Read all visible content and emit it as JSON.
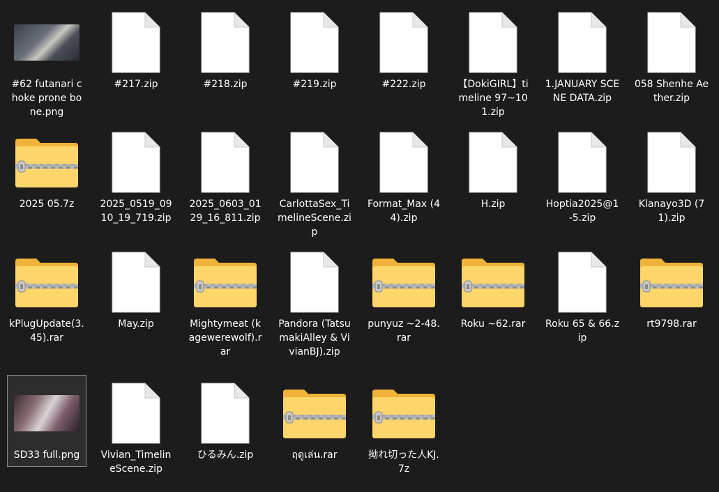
{
  "files": [
    {
      "name": "#62 futanari choke prone bone.png",
      "kind": "image",
      "thumb": "t1"
    },
    {
      "name": "#217.zip",
      "kind": "document"
    },
    {
      "name": "#218.zip",
      "kind": "document"
    },
    {
      "name": "#219.zip",
      "kind": "document"
    },
    {
      "name": "#222.zip",
      "kind": "document"
    },
    {
      "name": "【DokiGIRL】timeline 97~101.zip",
      "kind": "document"
    },
    {
      "name": "1.JANUARY SCENE DATA.zip",
      "kind": "document"
    },
    {
      "name": "058 Shenhe Aether.zip",
      "kind": "document"
    },
    {
      "name": "2025 05.7z",
      "kind": "zip-folder"
    },
    {
      "name": "2025_0519_0910_19_719.zip",
      "kind": "document"
    },
    {
      "name": "2025_0603_0129_16_811.zip",
      "kind": "document"
    },
    {
      "name": "CarlottaSex_TimelineScene.zip",
      "kind": "document"
    },
    {
      "name": "Format_Max (44).zip",
      "kind": "document"
    },
    {
      "name": "H.zip",
      "kind": "document"
    },
    {
      "name": "Hoptia2025@1-5.zip",
      "kind": "document"
    },
    {
      "name": "Klanayo3D (71).zip",
      "kind": "document"
    },
    {
      "name": "kPlugUpdate(3.45).rar",
      "kind": "zip-folder"
    },
    {
      "name": "May.zip",
      "kind": "document"
    },
    {
      "name": "Mightymeat (kagewerewolf).rar",
      "kind": "zip-folder"
    },
    {
      "name": "Pandora (TatsumakiAlley & VivianBJ).zip",
      "kind": "document"
    },
    {
      "name": "punyuz ~2-48.rar",
      "kind": "zip-folder"
    },
    {
      "name": "Roku ~62.rar",
      "kind": "zip-folder"
    },
    {
      "name": "Roku 65 & 66.zip",
      "kind": "document"
    },
    {
      "name": "rt9798.rar",
      "kind": "zip-folder"
    },
    {
      "name": "SD33 full.png",
      "kind": "image",
      "thumb": "t2",
      "selected": true
    },
    {
      "name": "Vivian_TimelineScene.zip",
      "kind": "document"
    },
    {
      "name": "ひるみん.zip",
      "kind": "document"
    },
    {
      "name": "ฤดูเล่น.rar",
      "kind": "zip-folder"
    },
    {
      "name": "拗れ切った人KJ.7z",
      "kind": "zip-folder"
    }
  ],
  "icons": {
    "document": "document-icon",
    "zip-folder": "compressed-folder-icon",
    "image": "image-thumbnail"
  },
  "colors": {
    "background": "#1c1c1c",
    "folder_back": "#f0b33a",
    "folder_front": "#fcd66a",
    "zipper": "#9a9a9a",
    "document": "#ffffff"
  }
}
